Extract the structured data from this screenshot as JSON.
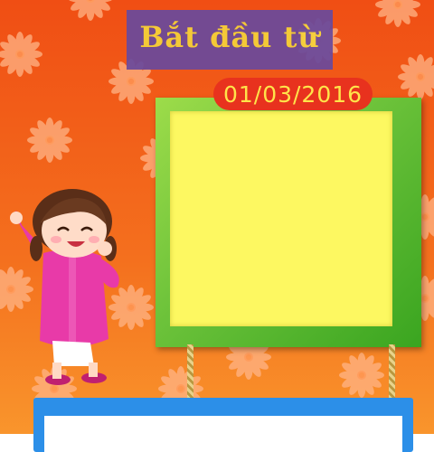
{
  "header": {
    "title": "Bắt đầu từ"
  },
  "date": {
    "value": "01/03/2016"
  },
  "colors": {
    "background_top": "#f15a1a",
    "background_bottom": "#f98f2a",
    "flower": "#ffb080",
    "title_box": "#6a4a9c",
    "title_text": "#f5d23a",
    "date_pill": "#e8321e",
    "date_text": "#ffe44a",
    "frame_green": "#5fbf34",
    "frame_fill": "#fdf861",
    "blue_panel": "#2c8fe8",
    "girl_dress": "#e83aa8"
  },
  "icons": {
    "character": "girl-character-icon",
    "decoration": "flower-icon"
  }
}
